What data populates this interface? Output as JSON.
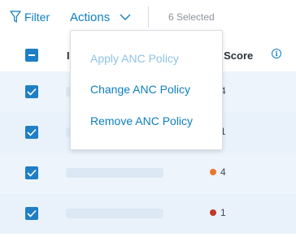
{
  "toolbar": {
    "filter_label": "Filter",
    "actions_label": "Actions",
    "selected_text": "6 Selected"
  },
  "table": {
    "header_col1": "I",
    "header_trust": "ust Score",
    "info_icon": "i",
    "rows": [
      {
        "checked": true,
        "name_partial": "",
        "dot_color": "",
        "score": "4"
      },
      {
        "checked": true,
        "name_partial": "",
        "dot_color": "",
        "score": "1"
      },
      {
        "checked": true,
        "name_partial": "",
        "dot_color": "#e8772e",
        "score": "4"
      },
      {
        "checked": true,
        "name_partial": "",
        "dot_color": "#c0392b",
        "score": "1"
      }
    ]
  },
  "menu": {
    "items": [
      {
        "label": "Apply ANC Policy",
        "enabled": false
      },
      {
        "label": "Change ANC Policy",
        "enabled": true
      },
      {
        "label": "Remove ANC Policy",
        "enabled": true
      }
    ]
  },
  "icons": {
    "filter": "filter-funnel-icon",
    "chevron": "chevron-down-icon",
    "check": "checkmark-icon",
    "info": "info-circle-icon"
  },
  "colors": {
    "accent": "#0d7fc1",
    "checkbox": "#1e7fc5",
    "row_bg": "#e9f2fa",
    "disabled_text": "#8fc3e3",
    "dot_orange": "#e8772e",
    "dot_red": "#c0392b"
  }
}
